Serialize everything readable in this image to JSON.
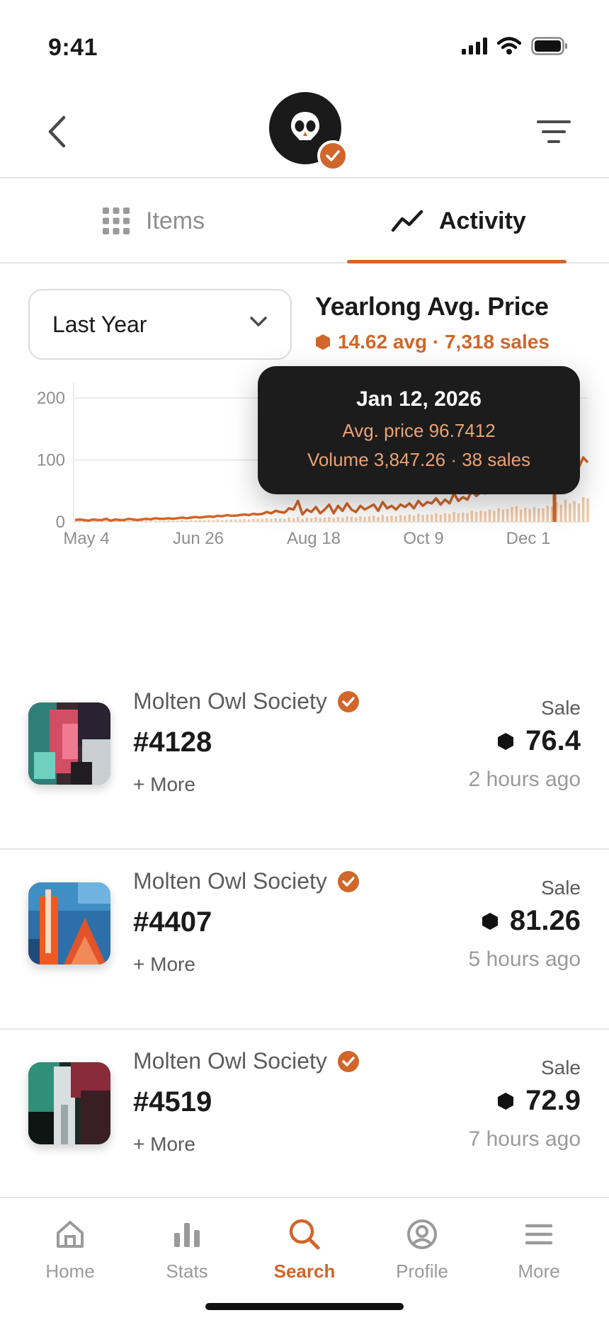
{
  "status": {
    "time": "9:41"
  },
  "colors": {
    "accent": "#d0662a",
    "accent_light": "#f2c9a8",
    "tooltip_bg": "#1c1c1c"
  },
  "header": {
    "back_icon": "chevron-left-icon",
    "filter_icon": "filter-lines-icon",
    "avatar_icon": "owl-skull-icon",
    "verified_icon": "check-badge-icon"
  },
  "tabs": [
    {
      "label": "Items",
      "icon": "grid-icon",
      "active": false
    },
    {
      "label": "Activity",
      "icon": "trend-line-icon",
      "active": true
    }
  ],
  "range": {
    "selected": "Last Year"
  },
  "summary": {
    "title": "Yearlong Avg. Price",
    "subtitle": "14.62 avg · 7,318 sales"
  },
  "chart_data": {
    "type": "line",
    "title": "Yearlong Avg. Price",
    "xlabel": "",
    "ylabel": "",
    "yticks": [
      "200",
      "100",
      "0"
    ],
    "ylim": [
      0,
      200
    ],
    "xticks": [
      "May 4",
      "Jun 26",
      "Aug 18",
      "Oct 9",
      "Dec 1"
    ],
    "grid": true,
    "series": [
      {
        "kind": "line",
        "values": [
          3,
          4,
          3,
          2,
          4,
          3,
          3,
          5,
          2,
          4,
          3,
          3,
          5,
          4,
          3,
          4,
          5,
          4,
          6,
          5,
          5,
          6,
          5,
          6,
          7,
          6,
          7,
          8,
          7,
          8,
          9,
          8,
          10,
          9,
          11,
          10,
          10,
          11,
          12,
          11,
          13,
          12,
          13,
          16,
          14,
          18,
          16,
          15,
          22,
          20,
          34,
          12,
          20,
          16,
          24,
          14,
          20,
          28,
          14,
          26,
          18,
          30,
          20,
          16,
          26,
          20,
          24,
          28,
          18,
          32,
          22,
          26,
          20,
          28,
          24,
          30,
          22,
          34,
          26,
          32,
          30,
          38,
          28,
          36,
          30,
          46,
          34,
          40,
          36,
          50,
          42,
          48,
          46,
          56,
          50,
          64,
          56,
          60,
          78,
          80,
          60,
          68,
          62,
          70,
          66,
          64,
          72,
          70,
          110,
          86,
          112,
          92,
          98,
          88,
          104,
          96
        ],
        "color": "#d0662a"
      },
      {
        "kind": "bars",
        "values": [
          1,
          2,
          1,
          1,
          2,
          1,
          1,
          2,
          1,
          2,
          1,
          1,
          2,
          2,
          1,
          2,
          2,
          1,
          2,
          2,
          2,
          3,
          2,
          2,
          3,
          2,
          3,
          3,
          3,
          3,
          4,
          3,
          4,
          3,
          4,
          4,
          4,
          4,
          5,
          4,
          5,
          5,
          5,
          6,
          5,
          6,
          6,
          5,
          7,
          6,
          8,
          5,
          7,
          6,
          8,
          6,
          7,
          8,
          6,
          8,
          7,
          9,
          8,
          7,
          9,
          8,
          9,
          10,
          8,
          11,
          9,
          10,
          9,
          11,
          10,
          12,
          10,
          13,
          11,
          12,
          12,
          14,
          12,
          14,
          13,
          16,
          14,
          15,
          14,
          18,
          16,
          18,
          17,
          20,
          18,
          22,
          20,
          21,
          24,
          25,
          20,
          23,
          21,
          24,
          22,
          22,
          26,
          25,
          32,
          28,
          36,
          30,
          34,
          30,
          40,
          38
        ],
        "color": "#f2c9a8"
      }
    ],
    "highlight": {
      "date": "Jan 12, 2026",
      "avg_price": 96.7412,
      "volume": 3847.26,
      "sales": 38
    }
  },
  "tooltip": {
    "date": "Jan 12, 2026",
    "avg_price_text": "Avg. price 96.7412",
    "volume_text": "Volume 3,847.26 · 38 sales"
  },
  "activities": [
    {
      "collection": "Molten Owl Society",
      "token": "#4128",
      "more": "+ More",
      "type": "Sale",
      "price": "76.4",
      "time": "2 hours ago",
      "art": "pink-teal"
    },
    {
      "collection": "Molten Owl Society",
      "token": "#4407",
      "more": "+ More",
      "type": "Sale",
      "price": "81.26",
      "time": "5 hours ago",
      "art": "blue-orange"
    },
    {
      "collection": "Molten Owl Society",
      "token": "#4519",
      "more": "+ More",
      "type": "Sale",
      "price": "72.9",
      "time": "7 hours ago",
      "art": "teal-dark"
    }
  ],
  "nav": [
    {
      "label": "Home",
      "icon": "home-icon",
      "active": false
    },
    {
      "label": "Stats",
      "icon": "bar-chart-icon",
      "active": false
    },
    {
      "label": "Search",
      "icon": "search-icon",
      "active": true
    },
    {
      "label": "Profile",
      "icon": "profile-icon",
      "active": false
    },
    {
      "label": "More",
      "icon": "menu-icon",
      "active": false
    }
  ]
}
